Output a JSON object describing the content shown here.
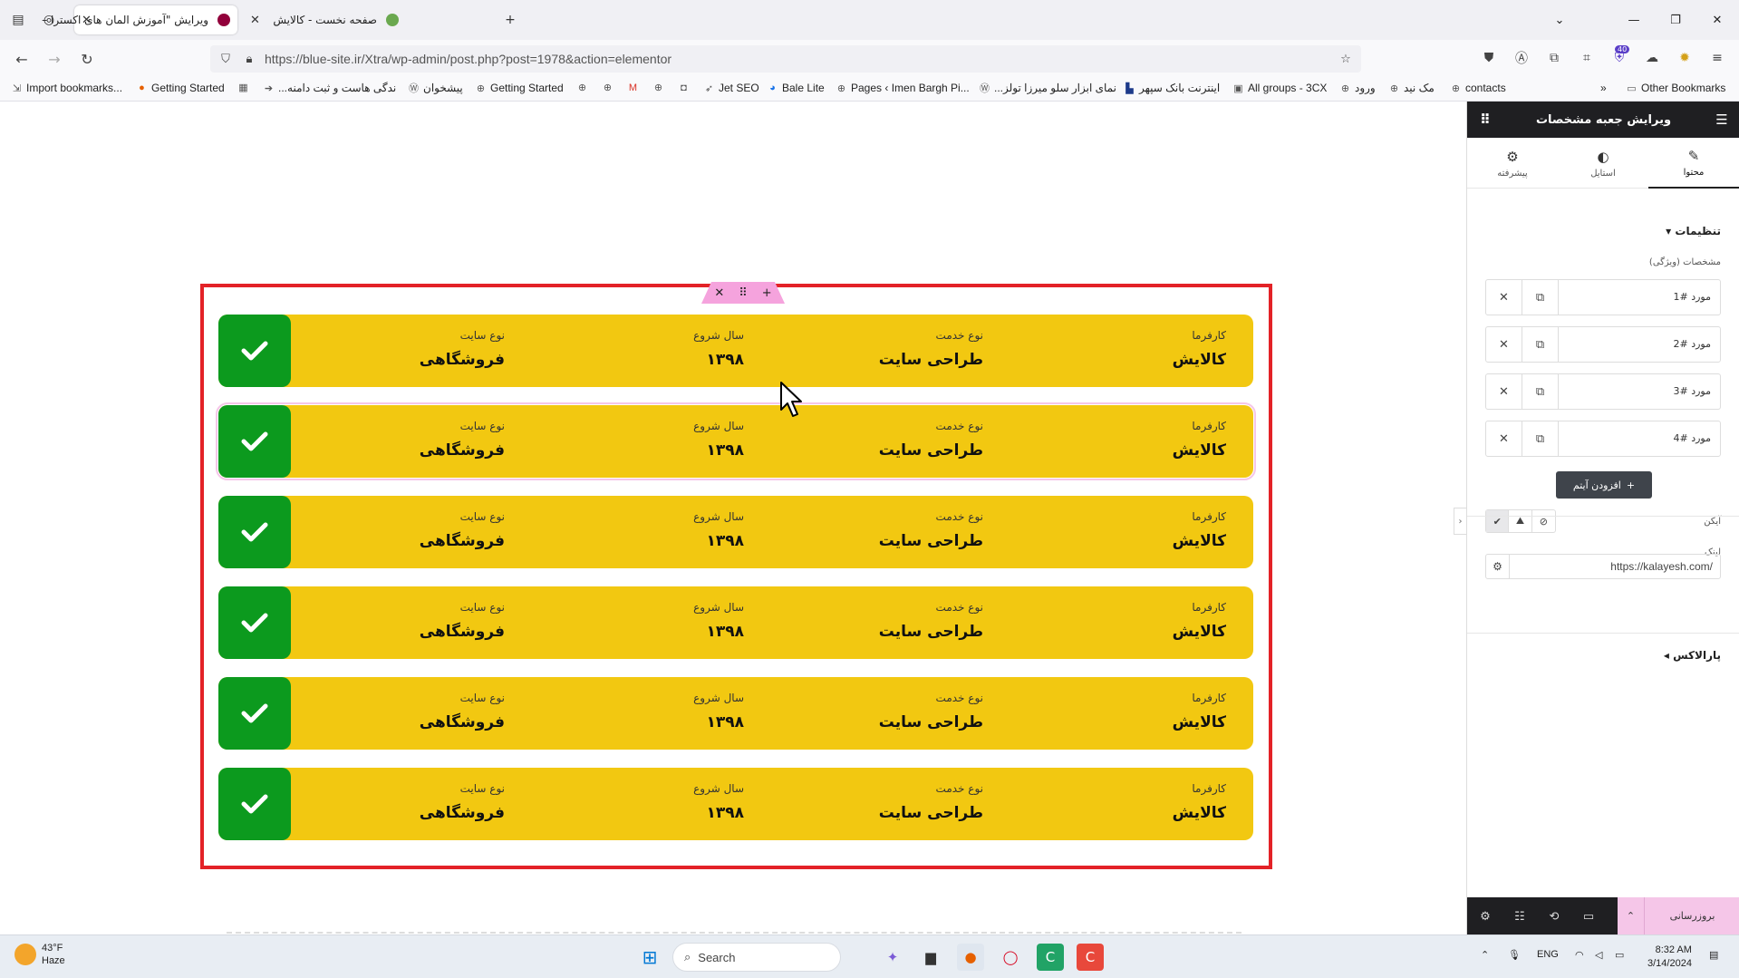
{
  "browser": {
    "tabs": [
      {
        "title": "ویرایش \"آموزش المان های اکسترا –",
        "active": true
      },
      {
        "title": "صفحه نخست - کالایش",
        "active": false
      }
    ],
    "url": "https://blue-site.ir/Xtra/wp-admin/post.php?post=1978&action=elementor",
    "extension_badge": "40",
    "bookmarks": [
      {
        "label": "Import bookmarks...",
        "icon": "import-icon"
      },
      {
        "label": "Getting Started",
        "icon": "firefox-icon"
      },
      {
        "label": "",
        "icon": "calendar-icon"
      },
      {
        "label": "...ندگی هاست و ثبت دامنه",
        "icon": "arrow-icon"
      },
      {
        "label": "پیشخوان",
        "icon": "wp-icon"
      },
      {
        "label": "Getting Started",
        "icon": "globe-icon"
      },
      {
        "label": "",
        "icon": "globe-icon"
      },
      {
        "label": "",
        "icon": "globe-icon"
      },
      {
        "label": "",
        "icon": "gmail-icon"
      },
      {
        "label": "",
        "icon": "globe-icon"
      },
      {
        "label": "",
        "icon": "app-icon"
      },
      {
        "label": "Jet SEO",
        "icon": "rocket-icon"
      },
      {
        "label": "Bale Lite",
        "icon": "bale-icon"
      },
      {
        "label": "Pages ‹ Imen Bargh Pi...",
        "icon": "globe-icon"
      },
      {
        "label": "...نمای ابزار سلو میرزا تولز",
        "icon": "wp-icon"
      },
      {
        "label": "اینترنت بانک سپهر",
        "icon": "bank-icon"
      },
      {
        "label": "All groups - 3CX",
        "icon": "3cx-icon"
      },
      {
        "label": "ورود",
        "icon": "globe-icon"
      },
      {
        "label": "مک نید",
        "icon": "globe-icon"
      },
      {
        "label": "contacts",
        "icon": "globe-icon"
      }
    ],
    "other_bookmarks": "Other Bookmarks"
  },
  "widget": {
    "rows": [
      {
        "f1_label": "کارفرما",
        "f1_value": "کالایش",
        "f2_label": "نوع خدمت",
        "f2_value": "طراحی سایت",
        "f3_label": "سال شروع",
        "f3_value": "۱۳۹۸",
        "f4_label": "نوع سایت",
        "f4_value": "فروشگاهی"
      },
      {
        "f1_label": "کارفرما",
        "f1_value": "کالایش",
        "f2_label": "نوع خدمت",
        "f2_value": "طراحی سایت",
        "f3_label": "سال شروع",
        "f3_value": "۱۳۹۸",
        "f4_label": "نوع سایت",
        "f4_value": "فروشگاهی"
      },
      {
        "f1_label": "کارفرما",
        "f1_value": "کالایش",
        "f2_label": "نوع خدمت",
        "f2_value": "طراحی سایت",
        "f3_label": "سال شروع",
        "f3_value": "۱۳۹۸",
        "f4_label": "نوع سایت",
        "f4_value": "فروشگاهی"
      },
      {
        "f1_label": "کارفرما",
        "f1_value": "کالایش",
        "f2_label": "نوع خدمت",
        "f2_value": "طراحی سایت",
        "f3_label": "سال شروع",
        "f3_value": "۱۳۹۸",
        "f4_label": "نوع سایت",
        "f4_value": "فروشگاهی"
      },
      {
        "f1_label": "کارفرما",
        "f1_value": "کالایش",
        "f2_label": "نوع خدمت",
        "f2_value": "طراحی سایت",
        "f3_label": "سال شروع",
        "f3_value": "۱۳۹۸",
        "f4_label": "نوع سایت",
        "f4_value": "فروشگاهی"
      },
      {
        "f1_label": "کارفرما",
        "f1_value": "کالایش",
        "f2_label": "نوع خدمت",
        "f2_value": "طراحی سایت",
        "f3_label": "سال شروع",
        "f3_value": "۱۳۹۸",
        "f4_label": "نوع سایت",
        "f4_value": "فروشگاهی"
      }
    ]
  },
  "panel": {
    "title": "ویرایش جعبه مشخصات",
    "tabs": [
      {
        "label": "محتوا",
        "icon": "pencil-icon"
      },
      {
        "label": "استایل",
        "icon": "contrast-icon"
      },
      {
        "label": "پیشرفته",
        "icon": "gear-icon"
      }
    ],
    "section_settings": "تنظیمات",
    "repeater_label": "مشخصات (ویژگی)",
    "items": [
      "مورد #1",
      "مورد #2",
      "مورد #3",
      "مورد #4"
    ],
    "add_item": "افزودن آیتم",
    "icon_label": "آیکن",
    "link_label": "لینک",
    "link_value": "https://kalayesh.com/",
    "section_parallax": "پارالاکس",
    "update_button": "بروزرسانی"
  },
  "taskbar": {
    "temperature": "43°F",
    "condition": "Haze",
    "search_placeholder": "Search",
    "language": "ENG",
    "time": "8:32 AM",
    "date": "3/14/2024"
  },
  "colors": {
    "row_bg": "#f2c811",
    "check_bg": "#0c9a1e",
    "widget_border": "#e32227",
    "panel_header": "#1f1f22",
    "accent_pink": "#f5c6e8"
  }
}
